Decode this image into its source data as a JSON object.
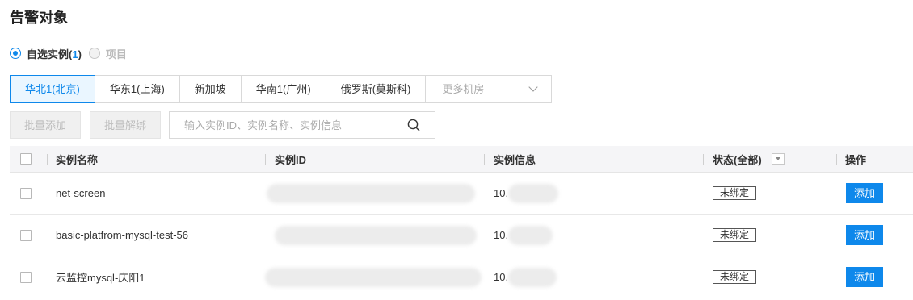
{
  "title": "告警对象",
  "scope": {
    "option1_label": "自选实例(",
    "option1_count": "1",
    "option1_close": ")",
    "option2_label": "项目"
  },
  "regions": [
    "华北1(北京)",
    "华东1(上海)",
    "新加坡",
    "华南1(广州)",
    "俄罗斯(莫斯科)"
  ],
  "regions_more": "更多机房",
  "toolbar": {
    "batch_add": "批量添加",
    "batch_unbind": "批量解绑",
    "search_placeholder": "输入实例ID、实例名称、实例信息"
  },
  "table": {
    "headers": {
      "name": "实例名称",
      "id": "实例ID",
      "info": "实例信息",
      "status": "状态(全部)",
      "action": "操作"
    },
    "rows": [
      {
        "name": "net-screen",
        "ip_prefix": "10.",
        "status": "未绑定",
        "action": "添加"
      },
      {
        "name": "basic-platfrom-mysql-test-56",
        "ip_prefix": "10.",
        "status": "未绑定",
        "action": "添加"
      },
      {
        "name": "云监控mysql-庆阳1",
        "ip_prefix": "10.",
        "status": "未绑定",
        "action": "添加"
      }
    ]
  },
  "colors": {
    "accent": "#0e88eb",
    "header_bg": "#f5f5f7"
  }
}
